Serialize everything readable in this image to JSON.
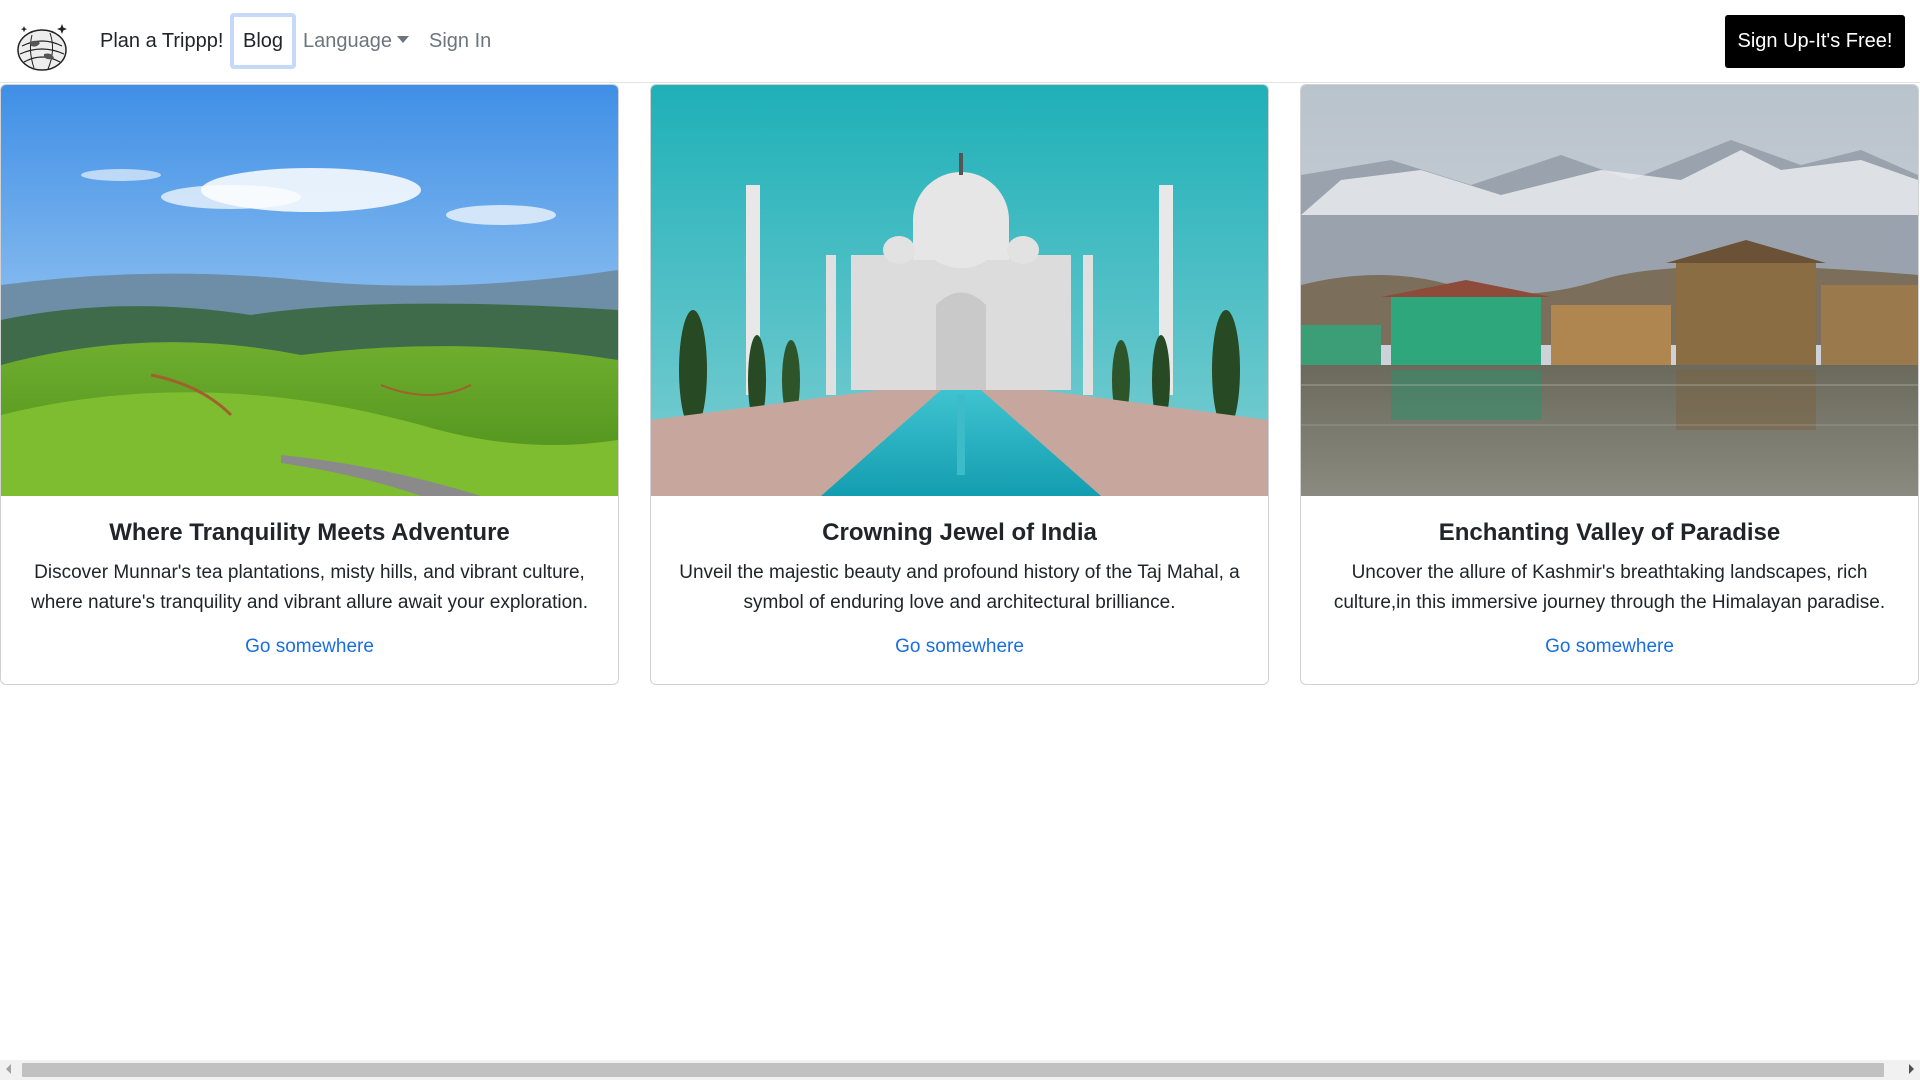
{
  "nav": {
    "brand": "Plan a Trippp!",
    "blog": "Blog",
    "language": "Language",
    "signin": "Sign In",
    "signup": "Sign Up-It's Free!"
  },
  "cards": [
    {
      "title": "Where Tranquility Meets Adventure",
      "text": "Discover Munnar's tea plantations, misty hills, and vibrant culture, where nature's tranquility and vibrant allure await your exploration.",
      "link": "Go somewhere"
    },
    {
      "title": "Crowning Jewel of India",
      "text": "Unveil the majestic beauty and profound history of the Taj Mahal, a symbol of enduring love and architectural brilliance.",
      "link": "Go somewhere"
    },
    {
      "title": "Enchanting Valley of Paradise",
      "text": "Uncover the allure of Kashmir's breathtaking landscapes, rich culture,in this immersive journey through the Himalayan paradise.",
      "link": "Go somewhere"
    }
  ],
  "colors": {
    "link": "#1a6fe0",
    "signup_bg": "#000000",
    "blog_focus": "#c5d9f8"
  }
}
